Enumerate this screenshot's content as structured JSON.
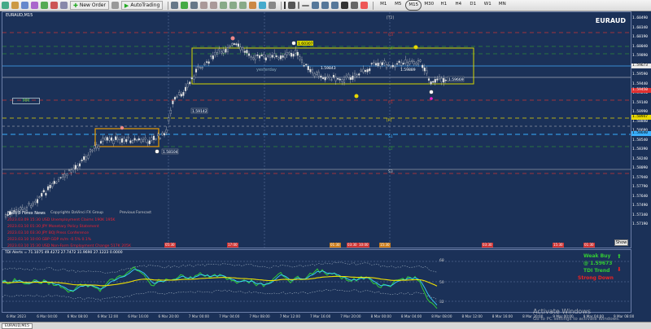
{
  "toolbar": {
    "new_order": "New Order",
    "auto_trading": "AutoTrading",
    "timeframes": [
      "M1",
      "M5",
      "M15",
      "M30",
      "H1",
      "H4",
      "D1",
      "W1",
      "MN"
    ],
    "active_timeframe": "M15"
  },
  "chart": {
    "symbol_corner": "EURAUD,M15",
    "symbol": "EURAUD",
    "mm_label": "MM",
    "yesterday_label": "yesterday",
    "show_button": "Show",
    "price_labels": [
      "1.60490",
      "1.60340",
      "1.60190",
      "1.60040",
      "1.59890",
      "1.59740",
      "1.59590",
      "1.59440",
      "1.59290",
      "1.59140",
      "1.58990",
      "1.58840",
      "1.58690",
      "1.58540",
      "1.58390",
      "1.58240",
      "1.58090",
      "1.57940",
      "1.57790",
      "1.57640",
      "1.57490",
      "1.57340",
      "1.57190"
    ],
    "highlight_prices": [
      {
        "value": "1.59673",
        "color": "#e9e9e9",
        "text_color": "#000"
      },
      {
        "value": "1.59450",
        "color": "#e03030",
        "text_color": "#fff"
      },
      {
        "value": "1.58947",
        "color": "#e8d800",
        "text_color": "#000"
      },
      {
        "value": "1.58640",
        "color": "#3ab0ff",
        "text_color": "#000"
      }
    ],
    "level_tags": [
      "1.59142",
      "1.58104",
      "1.60307",
      "1.59843",
      "1.59889",
      "1.59669"
    ],
    "pivot_tags": [
      "[T2]",
      "R3",
      "R2",
      "R1",
      "[P]",
      "S1",
      "S2",
      "S3"
    ]
  },
  "news": {
    "title": "Next 5 Forex News",
    "copyright": "Copyrights DaVinci FX Group",
    "previous_header": "Previous",
    "forecast_header": "Forecast",
    "rows": [
      "2023.03.09 15:30  USD Unemployment Claims        190K    195K",
      "2023.03.10 01:30  JPY Monetary Policy Statement",
      "2023.03.10 03:30  JPY BOJ Press Conference",
      "2023.03.10 10:00  GBP GDP m/m                    -0.5%   0.1%",
      "2023.03.10 15:30  USD Non-Farm Employment Change  517K    205K"
    ]
  },
  "event_markers": [
    "05:30",
    "17:00",
    "01:30",
    "03:30",
    "10:00",
    "15:30",
    "03:30",
    "15:30",
    "01:30"
  ],
  "indicator": {
    "title": "TDI Alerts = 71.1075 49.4272 27.7472 31.9690 27.1223 0.0000",
    "weak_buy": "Weak Buy",
    "weak_price": "@ 1.59673",
    "tdi_trend": "TDI Trend",
    "strong_down": "Strong Down",
    "levels": [
      "68",
      "50",
      "32"
    ]
  },
  "time_axis": [
    "6 Mar 2023",
    "6 Mar 04:00",
    "6 Mar 08:00",
    "6 Mar 12:00",
    "6 Mar 16:00",
    "6 Mar 20:00",
    "7 Mar 00:00",
    "7 Mar 04:00",
    "7 Mar 08:00",
    "7 Mar 12:00",
    "7 Mar 16:00",
    "7 Mar 20:00",
    "8 Mar 00:00",
    "8 Mar 04:00",
    "8 Mar 08:00",
    "8 Mar 12:00",
    "8 Mar 16:00",
    "8 Mar 20:00",
    "9 Mar 00:00",
    "9 Mar 04:00",
    "9 Mar 08:00"
  ],
  "tab": "EURAUD,M15",
  "watermark": {
    "line1": "Activate Windows",
    "line2": "Go to PC settings to activate Windows."
  }
}
